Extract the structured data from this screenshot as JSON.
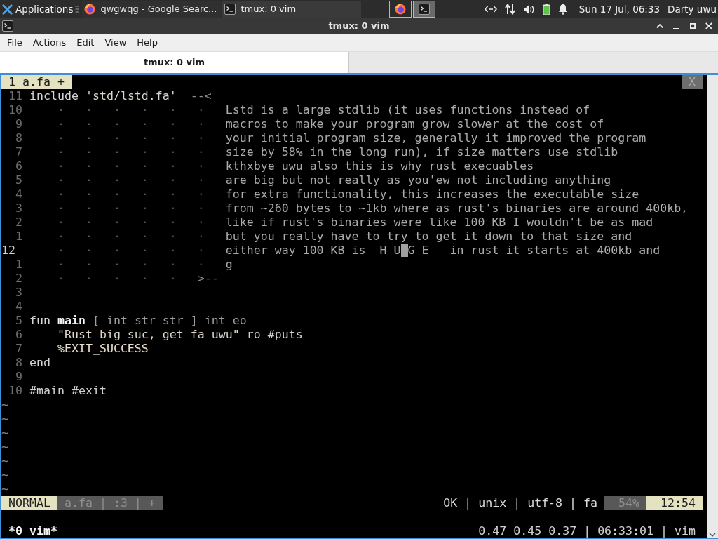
{
  "taskbar": {
    "apps_label": "Applications",
    "tasks": [
      {
        "kind": "browser",
        "title": "qwgwqg - Google Searc...",
        "selected": false
      },
      {
        "kind": "terminal",
        "title": "tmux: 0 vim",
        "selected": true
      }
    ],
    "launchers": [
      {
        "kind": "browser",
        "selected": false
      },
      {
        "kind": "terminal",
        "selected": true
      }
    ],
    "clock": "Sun 17 Jul, 06:33",
    "user": "Darty uwu"
  },
  "window": {
    "title": "tmux: 0 vim"
  },
  "menu": [
    "File",
    "Actions",
    "Edit",
    "View",
    "Help"
  ],
  "tabs": [
    {
      "label": "tmux: 0 vim",
      "selected": true
    }
  ],
  "vim": {
    "tabline": {
      "tabs": [
        {
          "label": "1 a.fa +",
          "selected": true
        }
      ],
      "close": "X"
    },
    "lines": [
      {
        "number": "11",
        "current": false,
        "segments": [
          {
            "kind": "keyword",
            "text": "include"
          },
          {
            "kind": "string",
            "text": " 'std/lstd.fa'"
          },
          {
            "kind": "marker",
            "text": "  --<"
          }
        ]
      },
      {
        "number": "10",
        "current": false,
        "segments": [
          {
            "kind": "whitespace",
            "text": "    ·   ·   ·   ·   ·   ·"
          },
          {
            "kind": "comment",
            "text": "   Lstd is a large stdlib (it uses functions instead of"
          }
        ]
      },
      {
        "number": "9",
        "current": false,
        "segments": [
          {
            "kind": "whitespace",
            "text": "    ·   ·   ·   ·   ·   ·"
          },
          {
            "kind": "comment",
            "text": "   macros to make your program grow slower at the cost of"
          }
        ]
      },
      {
        "number": "8",
        "current": false,
        "segments": [
          {
            "kind": "whitespace",
            "text": "    ·   ·   ·   ·   ·   ·"
          },
          {
            "kind": "comment",
            "text": "   your initial program size, generally it improved the program"
          }
        ]
      },
      {
        "number": "7",
        "current": false,
        "segments": [
          {
            "kind": "whitespace",
            "text": "    ·   ·   ·   ·   ·   ·"
          },
          {
            "kind": "comment",
            "text": "   size by 58% in the long run), if size matters use stdlib"
          }
        ]
      },
      {
        "number": "6",
        "current": false,
        "segments": [
          {
            "kind": "whitespace",
            "text": "    ·   ·   ·   ·   ·   ·"
          },
          {
            "kind": "comment",
            "text": "   kthxbye uwu also this is why rust execuables"
          }
        ]
      },
      {
        "number": "5",
        "current": false,
        "segments": [
          {
            "kind": "whitespace",
            "text": "    ·   ·   ·   ·   ·   ·"
          },
          {
            "kind": "comment",
            "text": "   are big but not really as you'ew not including anything"
          }
        ]
      },
      {
        "number": "4",
        "current": false,
        "segments": [
          {
            "kind": "whitespace",
            "text": "    ·   ·   ·   ·   ·   ·"
          },
          {
            "kind": "comment",
            "text": "   for extra functionality, this increases the executable size"
          }
        ]
      },
      {
        "number": "3",
        "current": false,
        "segments": [
          {
            "kind": "whitespace",
            "text": "    ·   ·   ·   ·   ·   ·"
          },
          {
            "kind": "comment",
            "text": "   from ~260 bytes to ~1kb where as rust's binaries are around 400kb,"
          }
        ]
      },
      {
        "number": "2",
        "current": false,
        "segments": [
          {
            "kind": "whitespace",
            "text": "    ·   ·   ·   ·   ·   ·"
          },
          {
            "kind": "comment",
            "text": "   like if rust's binaries were like 100 KB I wouldn't be as mad"
          }
        ]
      },
      {
        "number": "1",
        "current": false,
        "segments": [
          {
            "kind": "whitespace",
            "text": "    ·   ·   ·   ·   ·   ·"
          },
          {
            "kind": "comment",
            "text": "   but you really have to try to get it down to that size and"
          }
        ]
      },
      {
        "number": "12",
        "current": true,
        "segments": [
          {
            "kind": "whitespace",
            "text": "    ·   ·   ·   ·   ·   ·"
          },
          {
            "kind": "comment",
            "text": "   either way 100 KB is  H U"
          },
          {
            "kind": "cursor"
          },
          {
            "kind": "comment",
            "text": "G E   in rust it starts at 400kb and"
          }
        ]
      },
      {
        "number": "1",
        "current": false,
        "segments": [
          {
            "kind": "whitespace",
            "text": "    ·   ·   ·   ·   ·   ·"
          },
          {
            "kind": "comment",
            "text": "   g"
          }
        ]
      },
      {
        "number": "2",
        "current": false,
        "segments": [
          {
            "kind": "whitespace",
            "text": "    ·   ·   ·   ·   ·"
          },
          {
            "kind": "marker",
            "text": "   >--"
          }
        ]
      },
      {
        "number": "3",
        "current": false
      },
      {
        "number": "4",
        "current": false
      },
      {
        "number": "5",
        "current": false,
        "segments": [
          {
            "kind": "keyword",
            "text": "fun"
          },
          {
            "kind": "function",
            "text": " main"
          },
          {
            "kind": "type",
            "text": " [ int str str ] int eo"
          }
        ]
      },
      {
        "number": "6",
        "current": false,
        "segments": [
          {
            "kind": "string",
            "text": "    \"Rust big suc, get fa uwu\""
          },
          {
            "kind": "plain",
            "text": " ro #puts"
          }
        ]
      },
      {
        "number": "7",
        "current": false,
        "segments": [
          {
            "kind": "constant",
            "text": "    %EXIT_SUCCESS"
          }
        ]
      },
      {
        "number": "8",
        "current": false,
        "segments": [
          {
            "kind": "keyword",
            "text": "end"
          }
        ]
      },
      {
        "number": "9",
        "current": false
      },
      {
        "number": "10",
        "current": false,
        "segments": [
          {
            "kind": "plain",
            "text": "#main #exit"
          }
        ]
      }
    ],
    "filler": [
      "~",
      "~",
      "~",
      "~",
      "~",
      "~",
      "~"
    ],
    "statusline": {
      "mode": "NORMAL",
      "file_info": "a.fa | :3 | +",
      "file_format": "OK | unix | utf-8 | fa",
      "percent": "54%",
      "position": "12:54"
    }
  },
  "tmux_status": {
    "window": "*0 vim*",
    "info": "0.47 0.45 0.37 | 06:33:01 | vim"
  }
}
